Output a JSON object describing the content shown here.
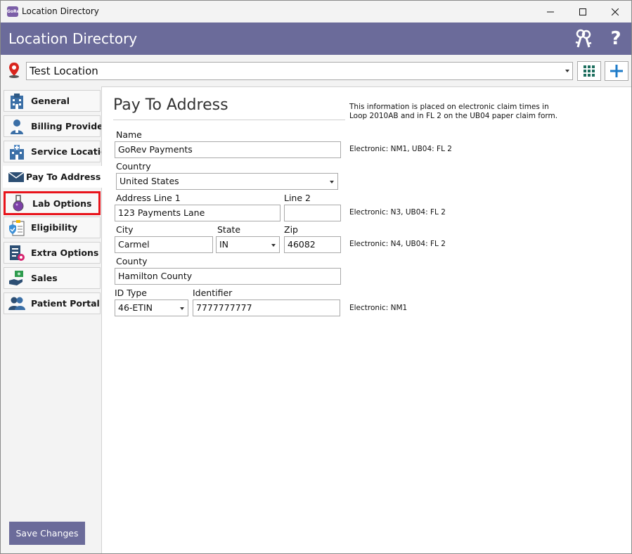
{
  "window": {
    "title": "Location Directory"
  },
  "header": {
    "title": "Location Directory",
    "accent": "#6b6b9a"
  },
  "location": {
    "selected": "Test Location"
  },
  "sidebar": {
    "items": [
      {
        "label": "General",
        "icon": "building-icon"
      },
      {
        "label": "Billing Provider",
        "icon": "provider-icon"
      },
      {
        "label": "Service Location",
        "icon": "hospital-icon"
      },
      {
        "label": "Pay To Address",
        "icon": "envelope-icon",
        "active": true
      },
      {
        "label": "Lab Options",
        "icon": "flask-icon",
        "highlighted": true
      },
      {
        "label": "Eligibility",
        "icon": "clipboard-shield-icon"
      },
      {
        "label": "Extra Options",
        "icon": "document-gear-icon"
      },
      {
        "label": "Sales",
        "icon": "money-hand-icon"
      },
      {
        "label": "Patient Portal",
        "icon": "users-icon"
      }
    ],
    "save_label": "Save Changes"
  },
  "main": {
    "section_title": "Pay To Address",
    "note": "This information is placed on electronic claim times in Loop 2010AB and in FL 2 on the UB04 paper claim form.",
    "name": {
      "label": "Name",
      "value": "GoRev Payments",
      "hint": "Electronic: NM1, UB04: FL 2"
    },
    "country": {
      "label": "Country",
      "value": "United States"
    },
    "address1": {
      "label": "Address Line 1",
      "value": "123 Payments Lane"
    },
    "address2": {
      "label": "Line 2",
      "value": "",
      "hint": "Electronic: N3, UB04: FL 2"
    },
    "city": {
      "label": "City",
      "value": "Carmel"
    },
    "state": {
      "label": "State",
      "value": "IN"
    },
    "zip": {
      "label": "Zip",
      "value": "46082",
      "hint": "Electronic: N4, UB04: FL 2"
    },
    "county": {
      "label": "County",
      "value": "Hamilton County"
    },
    "id_type": {
      "label": "ID Type",
      "value": "46-ETIN"
    },
    "identifier": {
      "label": "Identifier",
      "value": "7777777777",
      "hint": "Electronic: NM1"
    }
  }
}
